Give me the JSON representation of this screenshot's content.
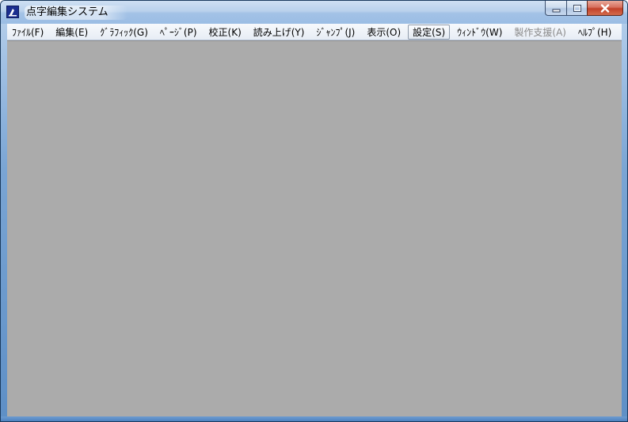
{
  "window": {
    "title": "点字編集システム",
    "icon": "braille-app-icon"
  },
  "controls": {
    "minimize": "minimize-icon",
    "maximize": "maximize-icon",
    "close": "close-icon"
  },
  "menu": {
    "items": [
      {
        "label": "ﾌｧｲﾙ(F)",
        "state": "normal"
      },
      {
        "label": "編集(E)",
        "state": "normal"
      },
      {
        "label": "ｸﾞﾗﾌｨｯｸ(G)",
        "state": "normal"
      },
      {
        "label": "ﾍﾟｰｼﾞ(P)",
        "state": "normal"
      },
      {
        "label": "校正(K)",
        "state": "normal"
      },
      {
        "label": "読み上げ(Y)",
        "state": "normal"
      },
      {
        "label": "ｼﾞｬﾝﾌﾟ(J)",
        "state": "normal"
      },
      {
        "label": "表示(O)",
        "state": "normal"
      },
      {
        "label": "設定(S)",
        "state": "active"
      },
      {
        "label": "ｳｨﾝﾄﾞｳ(W)",
        "state": "normal"
      },
      {
        "label": "製作支援(A)",
        "state": "disabled"
      },
      {
        "label": "ﾍﾙﾌﾟ(H)",
        "state": "normal"
      }
    ]
  },
  "colors": {
    "client_area": "#ababab",
    "menubar": "#e7edf5",
    "titlebar": "#b9d1ec"
  }
}
